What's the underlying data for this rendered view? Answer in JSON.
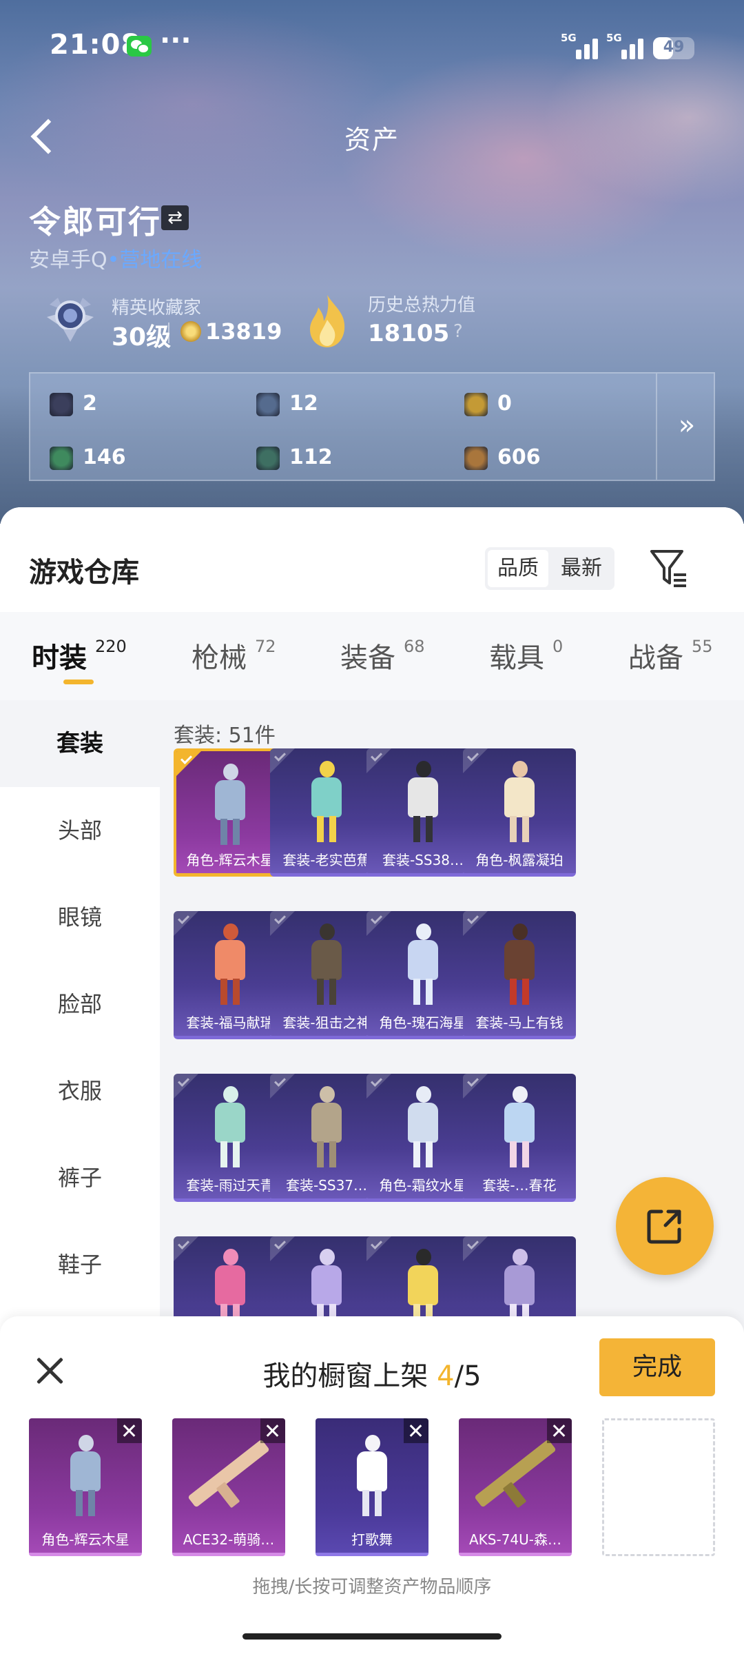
{
  "status_bar": {
    "time": "21:08",
    "dots": "···",
    "signal1_tag": "5G",
    "signal2_tag": "5G",
    "battery": "49",
    "battery_level": 0.49
  },
  "header": {
    "title": "资产",
    "back_icon": "back-arrow-icon"
  },
  "user": {
    "name": "令郎可行",
    "switch_icon": "⇄",
    "platform": "安卓手Q",
    "status_dot": "•",
    "status": "营地在线"
  },
  "rank": {
    "title": "精英收藏家",
    "level": "30级",
    "points": "13819"
  },
  "heat": {
    "title": "历史总热力值",
    "value": "18105",
    "help": "?"
  },
  "assets": {
    "items": [
      {
        "icon": "card-icon",
        "value": "2",
        "color": "#3b3f5c"
      },
      {
        "icon": "token-s-icon",
        "value": "12",
        "color": "#556b8e"
      },
      {
        "icon": "gold-coin-icon",
        "value": "0",
        "color": "#c49a35"
      },
      {
        "icon": "green-card-icon",
        "value": "146",
        "color": "#3f8a5e"
      },
      {
        "icon": "green-orb-icon",
        "value": "112",
        "color": "#3e6f62"
      },
      {
        "icon": "bronze-coin-icon",
        "value": "606",
        "color": "#a9763c"
      }
    ],
    "more": "»"
  },
  "warehouse": {
    "title": "游戏仓库",
    "sort_options": [
      "品质",
      "最新"
    ],
    "sort_selected": "品质"
  },
  "tabs": [
    {
      "label": "时装",
      "count": "220",
      "active": true
    },
    {
      "label": "枪械",
      "count": "72",
      "active": false
    },
    {
      "label": "装备",
      "count": "68",
      "active": false
    },
    {
      "label": "载具",
      "count": "0",
      "active": false
    },
    {
      "label": "战备",
      "count": "55",
      "active": false
    }
  ],
  "side_nav": [
    "套装",
    "头部",
    "眼镜",
    "脸部",
    "衣服",
    "裤子",
    "鞋子"
  ],
  "side_nav_selected": "套装",
  "grid": {
    "count_text": "套装: 51件",
    "items": [
      {
        "label": "角色-辉云木星",
        "selected": true,
        "colors": [
          "#cfd6e6",
          "#9fb6d4",
          "#6f84a8"
        ]
      },
      {
        "label": "套装-老实芭蕉",
        "selected": false,
        "colors": [
          "#f2d24a",
          "#7fd0c8",
          "#f2d24a"
        ]
      },
      {
        "label": "套装-SS38…",
        "selected": false,
        "colors": [
          "#2a2a2e",
          "#e6e6e6",
          "#333337"
        ]
      },
      {
        "label": "角色-枫露凝珀",
        "selected": false,
        "colors": [
          "#e8c6a6",
          "#f3e6c8",
          "#e8d2b8"
        ]
      },
      {
        "label": "套装-福马献瑞",
        "selected": false,
        "colors": [
          "#d05a3a",
          "#ef8a68",
          "#b84a2e"
        ]
      },
      {
        "label": "套装-狙击之神",
        "selected": false,
        "colors": [
          "#3a3530",
          "#6a5a48",
          "#4a4238"
        ]
      },
      {
        "label": "角色-瑰石海星",
        "selected": false,
        "colors": [
          "#e9eef8",
          "#c8d6f2",
          "#e4ecfa"
        ]
      },
      {
        "label": "套装-马上有钱",
        "selected": false,
        "colors": [
          "#4a3026",
          "#6a4232",
          "#c23a2a"
        ]
      },
      {
        "label": "套装-雨过天青",
        "selected": false,
        "colors": [
          "#d8f0ea",
          "#9ad6c8",
          "#e6f4ef"
        ]
      },
      {
        "label": "套装-SS37…",
        "selected": false,
        "colors": [
          "#cdbfa8",
          "#b3a48a",
          "#9f8f76"
        ]
      },
      {
        "label": "角色-霜纹水星",
        "selected": false,
        "colors": [
          "#e7ecf6",
          "#d0dcee",
          "#eef2f9"
        ]
      },
      {
        "label": "套装-…春花",
        "selected": false,
        "colors": [
          "#eef0f6",
          "#bcd6f2",
          "#f2d6e6"
        ]
      },
      {
        "label": "",
        "selected": false,
        "colors": [
          "#f08cb8",
          "#e66aa0",
          "#f3a4c6"
        ]
      },
      {
        "label": "",
        "selected": false,
        "colors": [
          "#d8d0f0",
          "#b8a8e8",
          "#e8e0f6"
        ]
      },
      {
        "label": "",
        "selected": false,
        "colors": [
          "#2a2a2a",
          "#f2d45a",
          "#f6e6a0"
        ]
      },
      {
        "label": "",
        "selected": false,
        "colors": [
          "#cdbfe8",
          "#a89ad6",
          "#ede6f8"
        ]
      }
    ]
  },
  "share_fab": {
    "icon": "external-share-icon"
  },
  "shelf": {
    "title": "我的橱窗上架 ",
    "current": "4",
    "separator": "/",
    "total": "5",
    "done": "完成",
    "items": [
      {
        "label": "角色-辉云木星",
        "kind": "figure",
        "colors": [
          "#cfd6e6",
          "#9fb6d4",
          "#6f84a8"
        ]
      },
      {
        "label": "ACE32-萌骑…",
        "kind": "gun",
        "colors": [
          "#e9c6a8"
        ]
      },
      {
        "label": "打歌舞",
        "kind": "figure",
        "colors": [
          "#f4f4f8",
          "#ffffff",
          "#e6e6f2"
        ]
      },
      {
        "label": "AKS-74U-森…",
        "kind": "gun-camo",
        "colors": [
          "#b7a052"
        ]
      }
    ],
    "hint": "拖拽/长按可调整资产物品顺序"
  }
}
